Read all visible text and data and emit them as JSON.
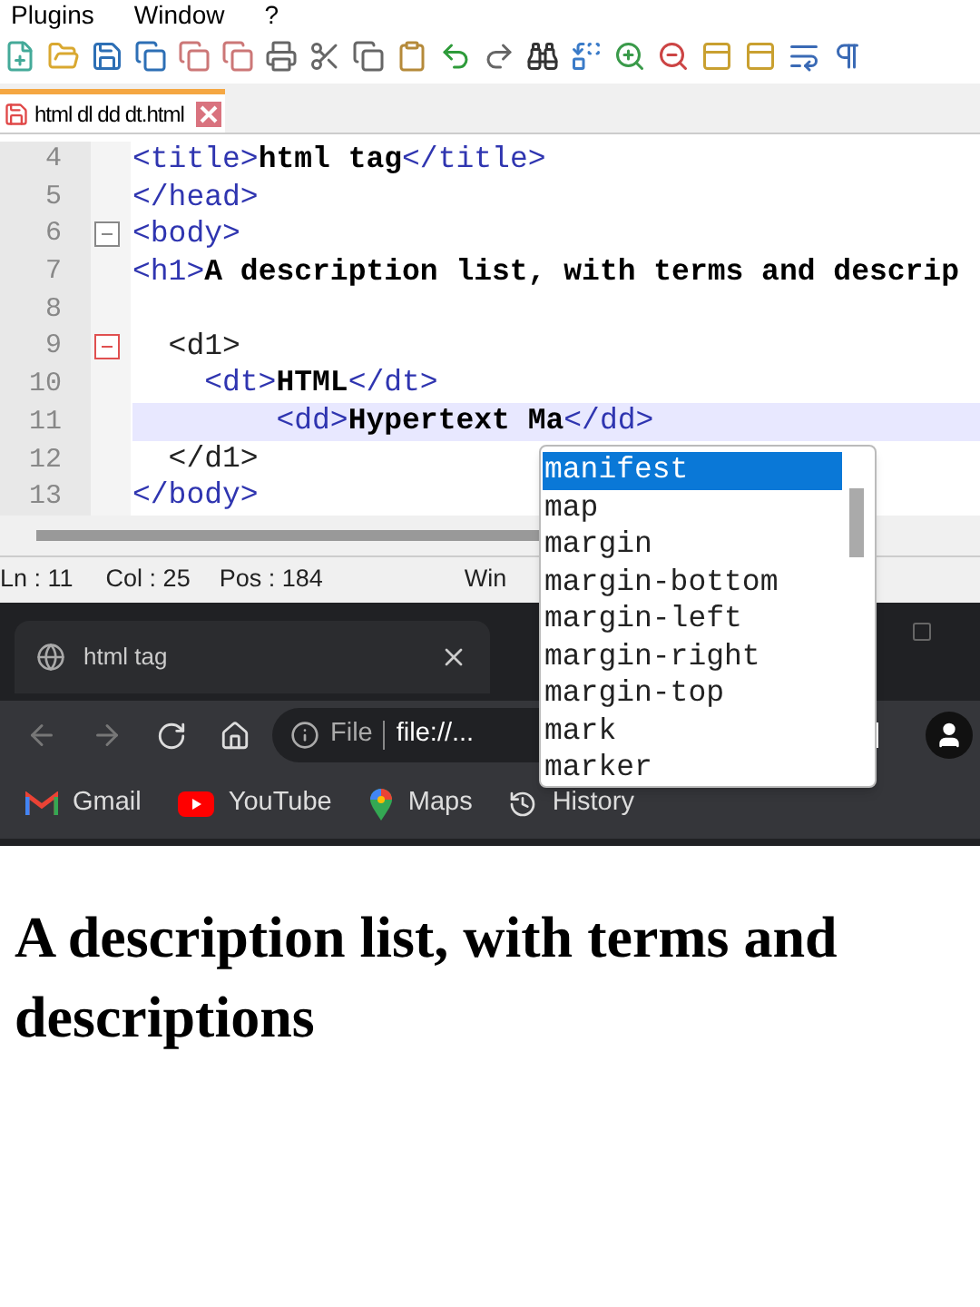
{
  "menu": [
    "Plugins",
    "Window",
    "?"
  ],
  "editor_tabs": [
    {
      "label": "html dl dd dt.html",
      "selected": true
    }
  ],
  "code_lines": [
    {
      "number": "4",
      "fold_toggle": false,
      "current": false,
      "segments": [
        {
          "kind": "tag",
          "text": "<title>"
        },
        {
          "kind": "text",
          "text": "html tag"
        },
        {
          "kind": "tag",
          "text": "</title>"
        }
      ]
    },
    {
      "number": "5",
      "fold_toggle": false,
      "current": false,
      "segments": [
        {
          "kind": "tag",
          "text": "</head>"
        }
      ]
    },
    {
      "number": "6",
      "fold_toggle": true,
      "active_block": false,
      "current": false,
      "segments": [
        {
          "kind": "tag",
          "text": "<body>"
        }
      ]
    },
    {
      "number": "7",
      "fold_toggle": false,
      "current": false,
      "segments": [
        {
          "kind": "tag",
          "text": "<h1>"
        },
        {
          "kind": "text",
          "text": "A description list, with terms and descrip"
        }
      ]
    },
    {
      "number": "8",
      "fold_toggle": false,
      "current": false
    },
    {
      "number": "9",
      "fold_toggle": true,
      "active_block": true,
      "current": false,
      "segments": [
        {
          "kind": "plain",
          "text": "  <d1>"
        }
      ]
    },
    {
      "number": "10",
      "fold_toggle": false,
      "current": false,
      "segments": [
        {
          "kind": "tag",
          "text": "    <dt>"
        },
        {
          "kind": "text",
          "text": "HTML"
        },
        {
          "kind": "tag",
          "text": "</dt>"
        }
      ]
    },
    {
      "number": "11",
      "fold_toggle": false,
      "current": true,
      "segments": [
        {
          "kind": "tag",
          "text": "        <dd>"
        },
        {
          "kind": "text",
          "text": "Hypertext Ma"
        },
        {
          "kind": "tag",
          "text": "</dd>"
        }
      ]
    },
    {
      "number": "12",
      "fold_toggle": false,
      "current": false,
      "segments": [
        {
          "kind": "plain",
          "text": "  </d1>"
        }
      ]
    },
    {
      "number": "13",
      "fold_toggle": false,
      "current": false,
      "segments": [
        {
          "kind": "tag",
          "text": "</body>"
        }
      ]
    }
  ],
  "autocomplete": [
    {
      "text": "manifest",
      "selected": true
    },
    {
      "text": "map",
      "selected": false
    },
    {
      "text": "margin",
      "selected": false
    },
    {
      "text": "margin-bottom",
      "selected": false
    },
    {
      "text": "margin-left",
      "selected": false
    },
    {
      "text": "margin-right",
      "selected": false
    },
    {
      "text": "margin-top",
      "selected": false
    },
    {
      "text": "mark",
      "selected": false
    },
    {
      "text": "marker",
      "selected": false
    }
  ],
  "status_bar": [
    "Ln : 11",
    "Col : 25",
    "Pos : 184",
    "Win"
  ],
  "browser": {
    "tab": "html tag",
    "address_scheme": "File",
    "address": "file://...",
    "bookmarks": [
      {
        "kind": "gmail",
        "label": "Gmail"
      },
      {
        "kind": "youtube",
        "label": "YouTube"
      },
      {
        "kind": "maps",
        "label": "Maps"
      },
      {
        "kind": "history",
        "label": "History"
      }
    ]
  },
  "page": {
    "heading": "A description list, with terms and descriptions"
  }
}
